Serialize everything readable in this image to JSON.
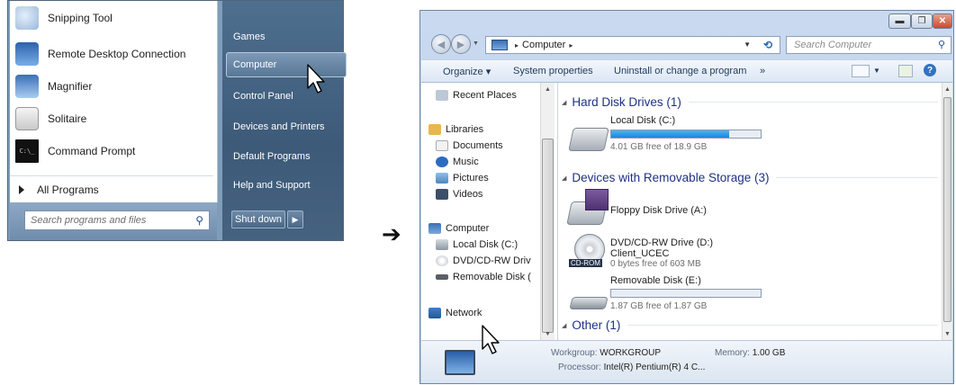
{
  "start_menu": {
    "left_items": [
      {
        "label": "Snipping Tool",
        "icon": "scissors-icon"
      },
      {
        "label": "Remote Desktop Connection",
        "icon": "remote-desktop-icon"
      },
      {
        "label": "Magnifier",
        "icon": "magnifier-icon"
      },
      {
        "label": "Solitaire",
        "icon": "cards-icon"
      },
      {
        "label": "Command Prompt",
        "icon": "terminal-icon"
      }
    ],
    "all_programs": "All Programs",
    "search_placeholder": "Search programs and files",
    "right_items": [
      "Games",
      "Computer",
      "Control Panel",
      "Devices and Printers",
      "Default Programs",
      "Help and Support"
    ],
    "shutdown": "Shut down",
    "shutdown_arrow": "▶"
  },
  "arrow": "➔",
  "explorer": {
    "address": {
      "location": "Computer",
      "sep": "▸",
      "drop": "▼",
      "refresh": "⟲"
    },
    "search_placeholder": "Search Computer",
    "toolbar": {
      "organize": "Organize ▾",
      "system_properties": "System properties",
      "uninstall": "Uninstall or change a program",
      "more": "»"
    },
    "nav": [
      {
        "label": "Recent Places",
        "icon": "recent-places-icon"
      },
      {
        "label": "Libraries",
        "icon": "libraries-icon"
      },
      {
        "label": "Documents",
        "icon": "documents-icon"
      },
      {
        "label": "Music",
        "icon": "music-icon"
      },
      {
        "label": "Pictures",
        "icon": "pictures-icon"
      },
      {
        "label": "Videos",
        "icon": "videos-icon"
      },
      {
        "label": "Computer",
        "icon": "computer-icon"
      },
      {
        "label": "Local Disk (C:)",
        "icon": "local-disk-icon"
      },
      {
        "label": "DVD/CD-RW Driv",
        "icon": "dvd-icon"
      },
      {
        "label": "Removable Disk (",
        "icon": "removable-disk-icon"
      },
      {
        "label": "Network",
        "icon": "network-icon"
      }
    ],
    "groups": {
      "hdd": "Hard Disk Drives (1)",
      "removable": "Devices with Removable Storage (3)",
      "other": "Other (1)"
    },
    "drives": {
      "c": {
        "name": "Local Disk (C:)",
        "free": "4.01 GB free of 18.9 GB",
        "used_fraction": 0.79
      },
      "a": {
        "name": "Floppy Disk Drive (A:)"
      },
      "d": {
        "name": "DVD/CD-RW Drive (D:)",
        "label": "Client_UCEC",
        "free": "0 bytes free of 603 MB",
        "tag": "CD-ROM"
      },
      "e": {
        "name": "Removable Disk (E:)",
        "free": "1.87 GB free of 1.87 GB",
        "used_fraction": 0.0
      }
    },
    "details": {
      "workgroup_label": "Workgroup:",
      "workgroup": "WORKGROUP",
      "memory_label": "Memory:",
      "memory": "1.00 GB",
      "processor_label": "Processor:",
      "processor": "Intel(R) Pentium(R) 4 C..."
    },
    "caption": {
      "min": "▬",
      "max": "❐",
      "close": "✕"
    },
    "help": "?"
  }
}
